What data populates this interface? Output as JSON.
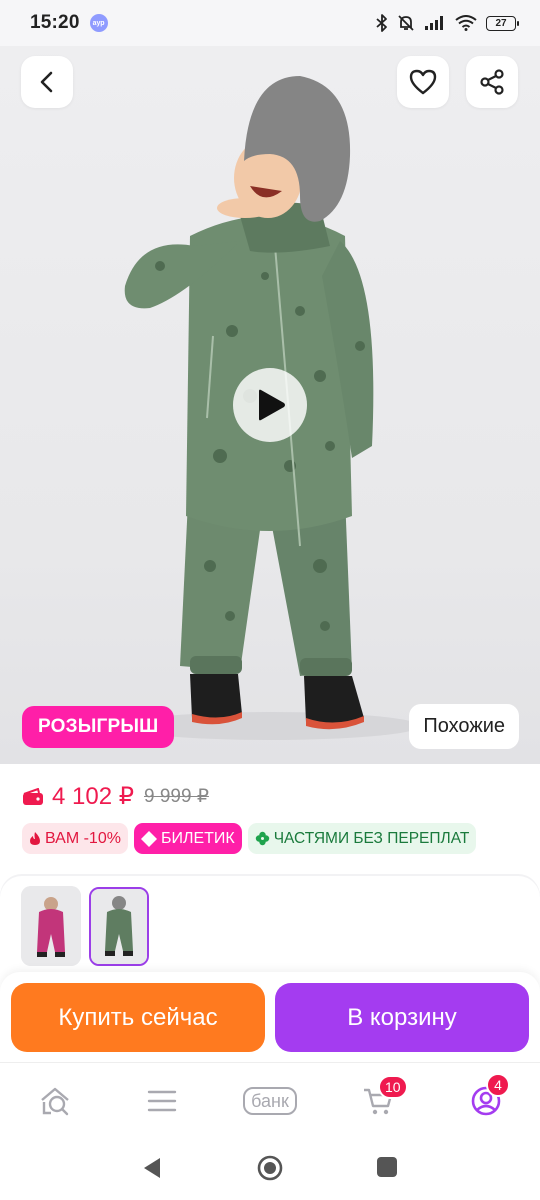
{
  "status_bar": {
    "time": "15:20",
    "badge": "аур",
    "battery": "27"
  },
  "hero": {
    "back_icon": "chevron-left-icon",
    "favorite_icon": "heart-icon",
    "share_icon": "share-icon",
    "play_icon": "play-icon",
    "raffle_badge": "РОЗЫГРЫШ",
    "similar_button": "Похожие"
  },
  "price": {
    "current": "4 102 ₽",
    "old": "9 999 ₽",
    "wallet_icon": "wallet-icon",
    "accent_color": "#ef1a4f"
  },
  "chips": {
    "discount": "ВАМ -10%",
    "ticket": "БИЛЕТИК",
    "installments": "ЧАСТЯМИ БЕЗ ПЕРЕПЛАТ"
  },
  "actions": {
    "buy_now": "Купить сейчас",
    "add_to_cart": "В корзину",
    "buy_color": "#ff7a1f",
    "cart_color": "#a43cf0"
  },
  "bottom_nav": {
    "bank": "банк",
    "cart_count": "10",
    "profile_count": "4"
  }
}
